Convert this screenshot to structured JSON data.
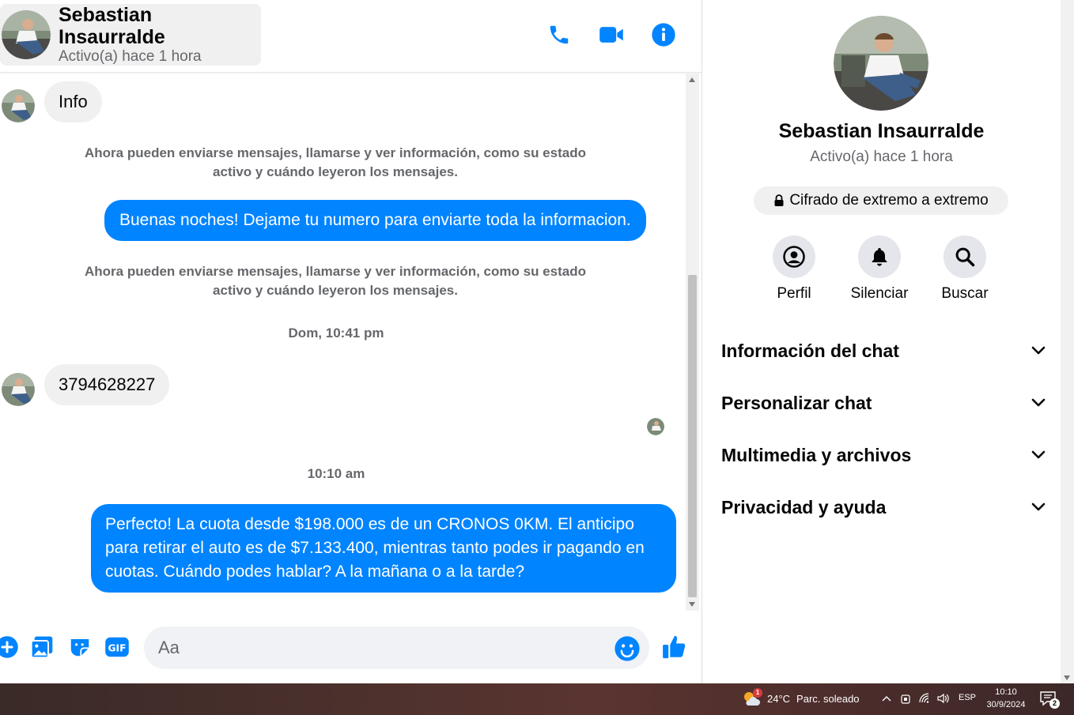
{
  "colors": {
    "accent": "#0084ff",
    "bubble_incoming": "#f0f0f0",
    "muted_text": "#65676b"
  },
  "header": {
    "name": "Sebastian Insaurralde",
    "status": "Activo(a) hace 1 hora",
    "icons": [
      "phone-icon",
      "video-camera-icon",
      "info-icon"
    ]
  },
  "messages": {
    "incoming_1": "Info",
    "system_1": "Ahora pueden enviarse mensajes, llamarse y ver información, como su estado activo y cuándo leyeron los mensajes.",
    "outgoing_1": "Buenas noches! Dejame tu numero para enviarte toda la informacion.",
    "system_2": "Ahora pueden enviarse mensajes, llamarse y ver información, como su estado activo y cuándo leyeron los mensajes.",
    "timestamp_1": "Dom, 10:41 pm",
    "incoming_2": "3794628227",
    "timestamp_2": "10:10 am",
    "outgoing_2": "Perfecto! La cuota desde $198.000 es de un CRONOS 0KM. El anticipo para retirar el auto es de $7.133.400, mientras tanto podes ir pagando en cuotas. Cuándo podes hablar? A la mañana o a la tarde?"
  },
  "composer": {
    "placeholder": "Aa",
    "icons": [
      "plus-icon",
      "image-icon",
      "sticker-icon",
      "gif-icon",
      "emoji-icon",
      "thumbs-up-icon"
    ],
    "gif_label": "GIF"
  },
  "info_panel": {
    "name": "Sebastian Insaurralde",
    "status": "Activo(a) hace 1 hora",
    "encryption": "Cifrado de extremo a extremo",
    "actions": [
      {
        "label": "Perfil",
        "icon": "profile-icon"
      },
      {
        "label": "Silenciar",
        "icon": "bell-icon"
      },
      {
        "label": "Buscar",
        "icon": "search-icon"
      }
    ],
    "sections": [
      {
        "label": "Información del chat"
      },
      {
        "label": "Personalizar chat"
      },
      {
        "label": "Multimedia y archivos"
      },
      {
        "label": "Privacidad y ayuda"
      }
    ]
  },
  "taskbar": {
    "weather_badge": "1",
    "temperature": "24°C",
    "condition": "Parc. soleado",
    "language": "ESP",
    "time": "10:10",
    "date": "30/9/2024",
    "notifications": "2"
  }
}
